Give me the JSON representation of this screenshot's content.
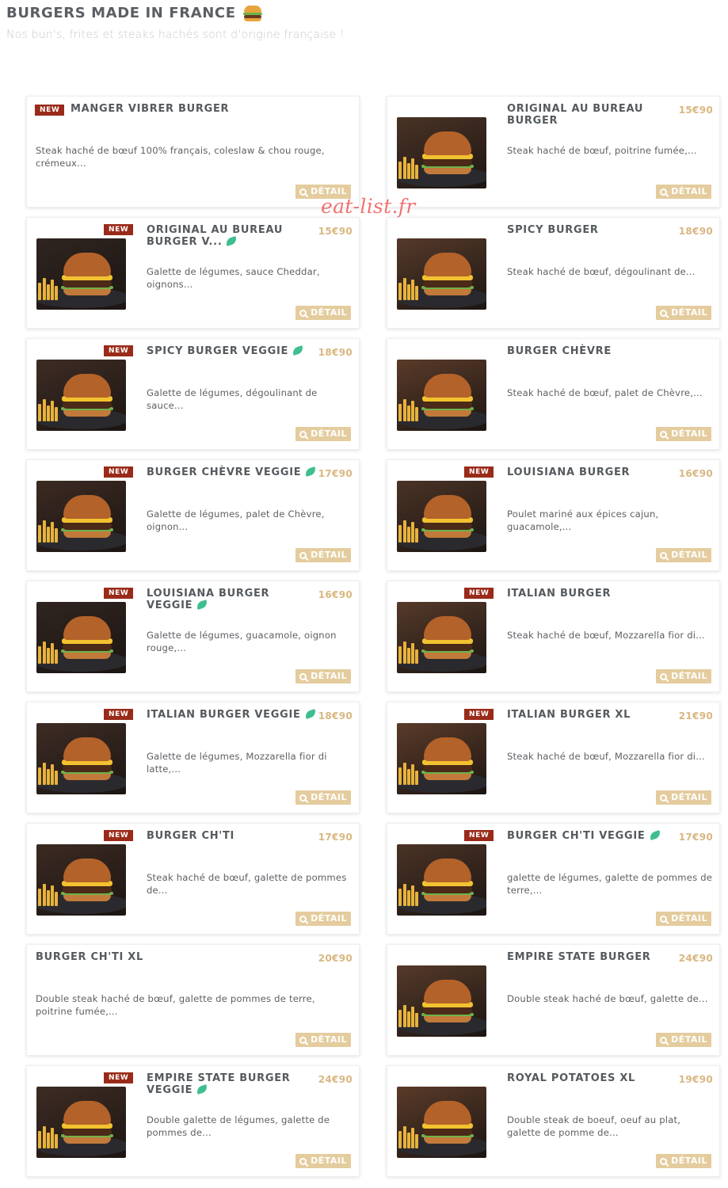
{
  "header": {
    "title": "BURGERS MADE IN FRANCE",
    "subtitle": "Nos bun's, frites et steaks hachés sont d'origine française !"
  },
  "watermark": "eat-list.fr",
  "ui": {
    "new_label": "NEW",
    "detail_label": "DÉTAIL"
  },
  "colors": {
    "price": "#d9b781",
    "new_badge": "#9a2a19",
    "detail_button": "#e4cc9e",
    "veggie_leaf": "#3fbf8f",
    "watermark": "#f05b5b"
  },
  "items": [
    {
      "title": "MANGER VIBRER BURGER",
      "price": "",
      "desc": "Steak haché de bœuf 100% français, coleslaw & chou rouge, crémeux...",
      "is_new": true,
      "veggie": false,
      "has_image": false
    },
    {
      "title": "ORIGINAL AU BUREAU BURGER",
      "price": "15€90",
      "desc": "Steak haché de bœuf, poitrine fumée,...",
      "is_new": false,
      "veggie": false,
      "has_image": true
    },
    {
      "title": "ORIGINAL AU BUREAU BURGER V...",
      "price": "15€90",
      "desc": "Galette de légumes, sauce Cheddar, oignons...",
      "is_new": true,
      "veggie": true,
      "has_image": true
    },
    {
      "title": "SPICY BURGER",
      "price": "18€90",
      "desc": "Steak haché de bœuf, dégoulinant de...",
      "is_new": false,
      "veggie": false,
      "has_image": true
    },
    {
      "title": "SPICY BURGER VEGGIE",
      "price": "18€90",
      "desc": "Galette de légumes, dégoulinant de sauce...",
      "is_new": true,
      "veggie": true,
      "has_image": true
    },
    {
      "title": "BURGER CHÈVRE",
      "price": "",
      "desc": "Steak haché de bœuf, palet de Chèvre,...",
      "is_new": false,
      "veggie": false,
      "has_image": true
    },
    {
      "title": "BURGER CHÈVRE VEGGIE",
      "price": "17€90",
      "desc": "Galette de légumes, palet de Chèvre, oignon...",
      "is_new": true,
      "veggie": true,
      "has_image": true
    },
    {
      "title": "LOUISIANA BURGER",
      "price": "16€90",
      "desc": "Poulet mariné aux épices cajun, guacamole,...",
      "is_new": true,
      "veggie": false,
      "has_image": true
    },
    {
      "title": "LOUISIANA BURGER VEGGIE",
      "price": "16€90",
      "desc": "Galette de légumes, guacamole, oignon rouge,...",
      "is_new": true,
      "veggie": true,
      "has_image": true
    },
    {
      "title": "ITALIAN BURGER",
      "price": "",
      "desc": "Steak haché de bœuf, Mozzarella fior di...",
      "is_new": true,
      "veggie": false,
      "has_image": true
    },
    {
      "title": "ITALIAN BURGER VEGGIE",
      "price": "18€90",
      "desc": "Galette de légumes, Mozzarella fior di latte,...",
      "is_new": true,
      "veggie": true,
      "has_image": true
    },
    {
      "title": "ITALIAN BURGER XL",
      "price": "21€90",
      "desc": "Steak haché de bœuf, Mozzarella fior di...",
      "is_new": true,
      "veggie": false,
      "has_image": true
    },
    {
      "title": "BURGER CH'TI",
      "price": "17€90",
      "desc": "Steak haché de bœuf, galette de pommes de...",
      "is_new": true,
      "veggie": false,
      "has_image": true
    },
    {
      "title": "BURGER CH'TI VEGGIE",
      "price": "17€90",
      "desc": "galette de légumes, galette de pommes de terre,...",
      "is_new": true,
      "veggie": true,
      "has_image": true
    },
    {
      "title": "BURGER CH'TI XL",
      "price": "20€90",
      "desc": "Double steak haché de bœuf, galette de pommes de terre, poitrine fumée,...",
      "is_new": false,
      "veggie": false,
      "has_image": false
    },
    {
      "title": "EMPIRE STATE BURGER",
      "price": "24€90",
      "desc": "Double steak haché de bœuf, galette de...",
      "is_new": false,
      "veggie": false,
      "has_image": true
    },
    {
      "title": "EMPIRE STATE BURGER VEGGIE",
      "price": "24€90",
      "desc": "Double galette de légumes, galette de pommes de...",
      "is_new": true,
      "veggie": true,
      "has_image": true
    },
    {
      "title": "ROYAL POTATOES XL",
      "price": "19€90",
      "desc": "Double steak de boeuf, oeuf au plat, galette de pomme de...",
      "is_new": false,
      "veggie": false,
      "has_image": true
    }
  ]
}
